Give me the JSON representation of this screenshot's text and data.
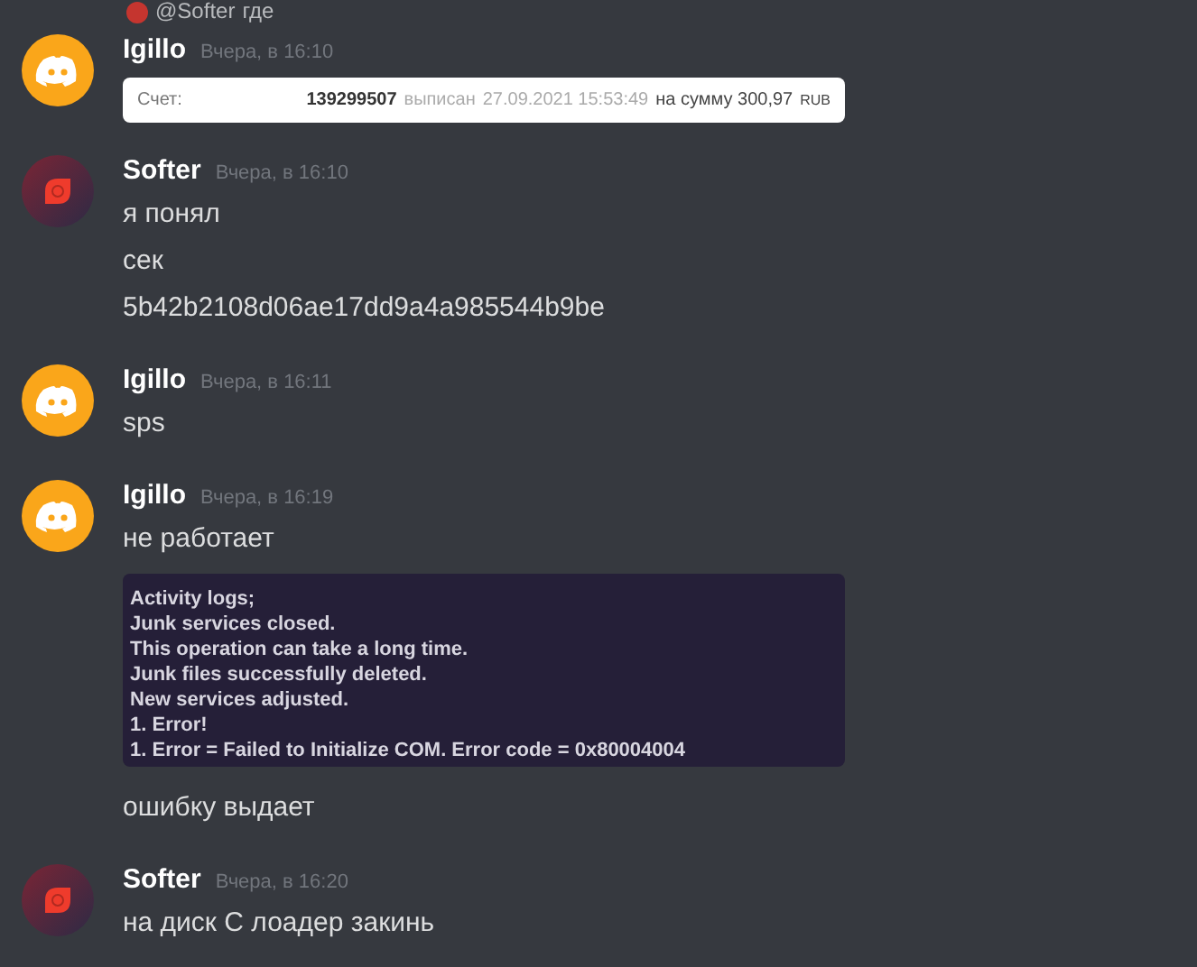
{
  "reply": {
    "author": "@Softer",
    "text": "где"
  },
  "messages": [
    {
      "author": "Igillo",
      "kind": "discord",
      "time": "Вчера, в 16:10",
      "items": [
        {
          "kind": "invoice",
          "label": "Счет:",
          "number": "139299507",
          "issued": "выписан",
          "date": "27.09.2021 15:53:49",
          "sum": "на сумму 300,97",
          "currency": "RUB"
        }
      ]
    },
    {
      "author": "Softer",
      "kind": "softer",
      "time": "Вчера, в 16:10",
      "items": [
        {
          "kind": "text",
          "text": "я понял"
        },
        {
          "kind": "text",
          "text": "сек"
        },
        {
          "kind": "text",
          "text": "5b42b2108d06ae17dd9a4a985544b9be"
        }
      ]
    },
    {
      "author": "Igillo",
      "kind": "discord",
      "time": "Вчера, в 16:11",
      "items": [
        {
          "kind": "text",
          "text": "sps"
        }
      ]
    },
    {
      "author": "Igillo",
      "kind": "discord",
      "time": "Вчера, в 16:19",
      "items": [
        {
          "kind": "text",
          "text": "не работает"
        },
        {
          "kind": "log",
          "lines": [
            "Activity logs;",
            "Junk services closed.",
            "This operation can take a long time.",
            "Junk files successfully deleted.",
            "New services adjusted.",
            "1. Error!",
            "1. Error = Failed to Initialize COM. Error code = 0x80004004"
          ]
        },
        {
          "kind": "text",
          "text": "ошибку выдает"
        }
      ]
    },
    {
      "author": "Softer",
      "kind": "softer",
      "time": "Вчера, в 16:20",
      "items": [
        {
          "kind": "text",
          "text": "на диск С лоадер закинь"
        }
      ]
    }
  ]
}
